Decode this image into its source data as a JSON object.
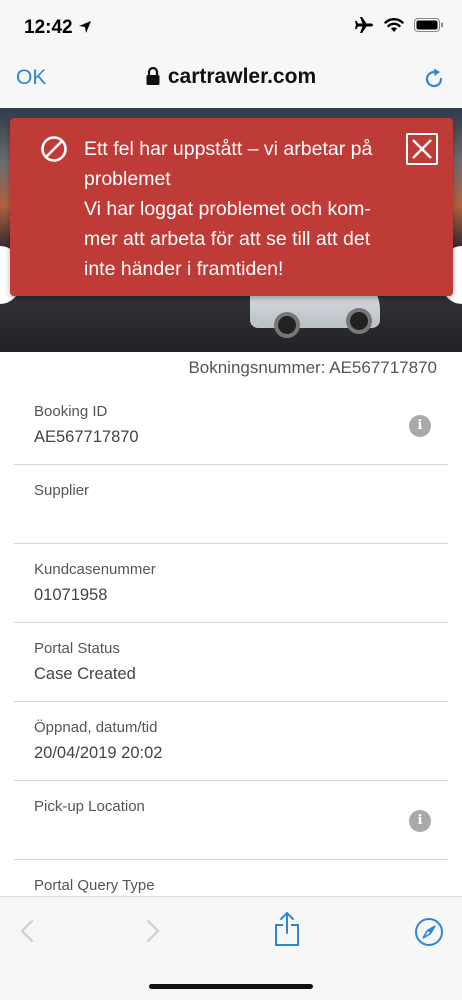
{
  "status_bar": {
    "time": "12:42"
  },
  "nav": {
    "ok_label": "OK",
    "url": "cartrawler.com"
  },
  "error": {
    "title": "Ett fel har uppstått – vi arbetar på problemet",
    "body": "Vi har loggat problemet och kom-mer att arbeta för att se till att det inte händer i framtiden!"
  },
  "booking_number": "Bokningsnummer: AE567717870",
  "rows": [
    {
      "label": "Booking ID",
      "value": "AE567717870"
    },
    {
      "label": "Supplier",
      "value": ""
    },
    {
      "label": "Kundcasenummer",
      "value": "01071958"
    },
    {
      "label": "Portal Status",
      "value": "Case Created"
    },
    {
      "label": "Öppnad, datum/tid",
      "value": "20/04/2019 20:02"
    },
    {
      "label": "Pick-up Location",
      "value": ""
    },
    {
      "label": "Portal Query Type",
      "value": ""
    }
  ],
  "colors": {
    "accent": "#2f86d8",
    "error_bg": "#bf3b37"
  },
  "icons": [
    "location-arrow-icon",
    "airplane-icon",
    "wifi-icon",
    "battery-icon",
    "lock-icon",
    "reload-icon",
    "ban-icon",
    "close-icon",
    "info-icon",
    "back-arrow-icon",
    "forward-arrow-icon",
    "share-icon",
    "compass-icon"
  ]
}
